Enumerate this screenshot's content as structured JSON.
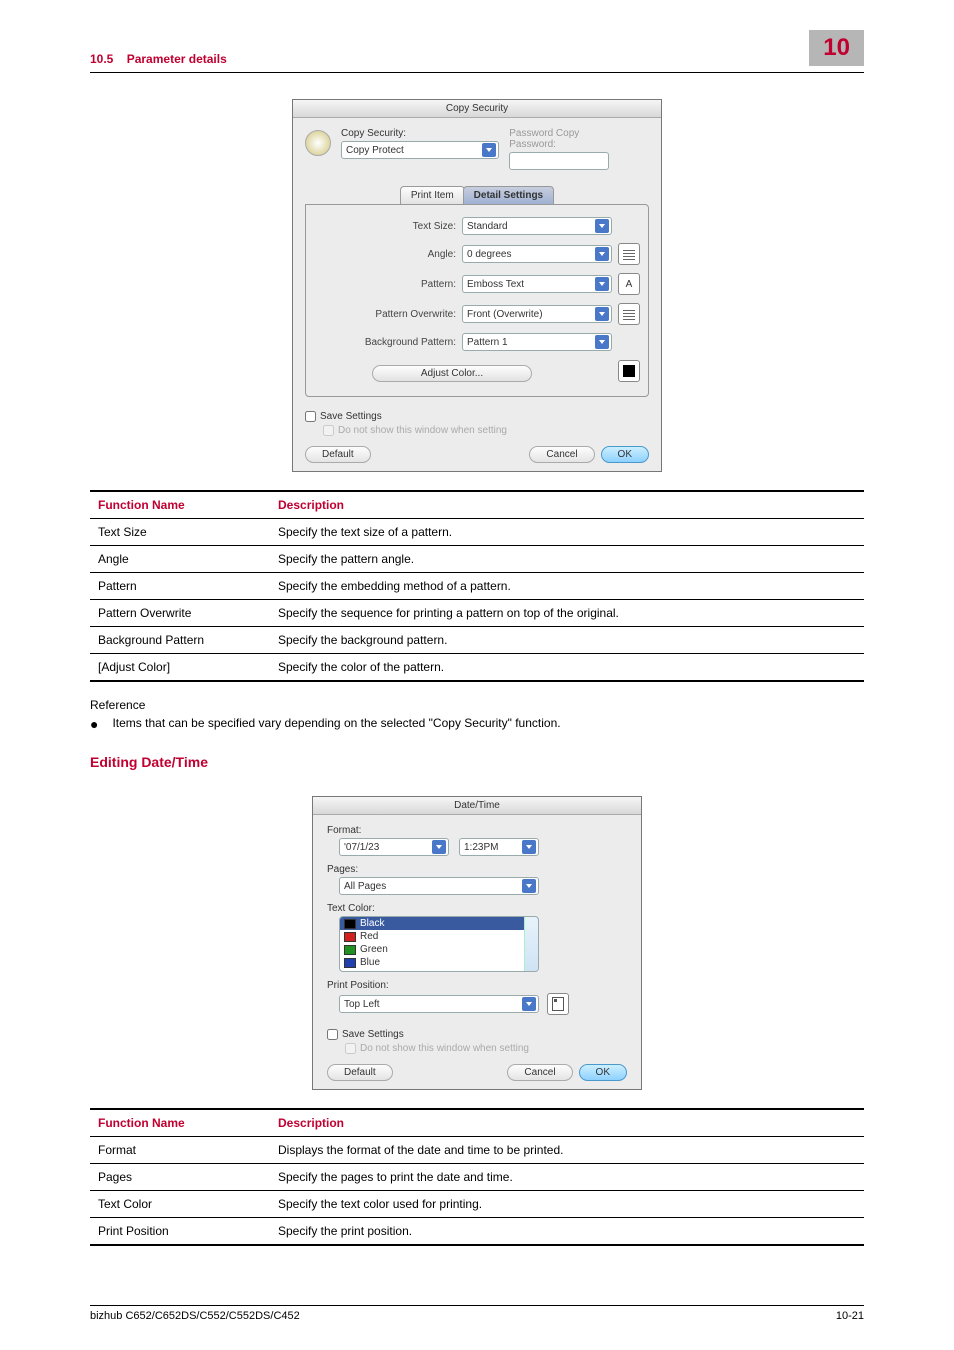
{
  "header": {
    "section_no": "10.5",
    "section_title": "Parameter details",
    "page_group": "10"
  },
  "dialog_copy": {
    "title": "Copy Security",
    "copy_security_label": "Copy Security:",
    "copy_security_value": "Copy Protect",
    "password_copy_label": "Password Copy",
    "password_label": "Password:",
    "tab_print_item": "Print Item",
    "tab_detail_settings": "Detail Settings",
    "rows": {
      "text_size": {
        "label": "Text Size:",
        "value": "Standard"
      },
      "angle": {
        "label": "Angle:",
        "value": "0 degrees"
      },
      "pattern": {
        "label": "Pattern:",
        "value": "Emboss Text"
      },
      "pattern_overwrite": {
        "label": "Pattern Overwrite:",
        "value": "Front (Overwrite)"
      },
      "background_pattern": {
        "label": "Background Pattern:",
        "value": "Pattern 1"
      }
    },
    "adjust_color": "Adjust Color...",
    "save_settings": "Save Settings",
    "donotshow": "Do not show this window when setting",
    "default": "Default",
    "cancel": "Cancel",
    "ok": "OK"
  },
  "table1": {
    "h1": "Function Name",
    "h2": "Description",
    "rows": [
      {
        "f": "Text Size",
        "d": "Specify the text size of a pattern."
      },
      {
        "f": "Angle",
        "d": "Specify the pattern angle."
      },
      {
        "f": "Pattern",
        "d": "Specify the embedding method of a pattern."
      },
      {
        "f": "Pattern Overwrite",
        "d": "Specify the sequence for printing a pattern on top of the original."
      },
      {
        "f": "Background Pattern",
        "d": "Specify the background pattern."
      },
      {
        "f": "[Adjust Color]",
        "d": "Specify the color of the pattern."
      }
    ]
  },
  "reference": {
    "title": "Reference",
    "bullet": "Items that can be specified vary depending on the selected \"Copy Security\" function."
  },
  "h_datetime": "Editing Date/Time",
  "dialog_dt": {
    "title": "Date/Time",
    "format_label": "Format:",
    "format_date": "'07/1/23",
    "format_time": "1:23PM",
    "pages_label": "Pages:",
    "pages_value": "All Pages",
    "text_color_label": "Text Color:",
    "colors": [
      {
        "name": "Black",
        "hex": "#000000",
        "selected": true
      },
      {
        "name": "Red",
        "hex": "#d02020"
      },
      {
        "name": "Green",
        "hex": "#209020"
      },
      {
        "name": "Blue",
        "hex": "#2040b0"
      }
    ],
    "print_position_label": "Print Position:",
    "print_position_value": "Top Left",
    "save_settings": "Save Settings",
    "donotshow": "Do not show this window when setting",
    "default": "Default",
    "cancel": "Cancel",
    "ok": "OK"
  },
  "table2": {
    "h1": "Function Name",
    "h2": "Description",
    "rows": [
      {
        "f": "Format",
        "d": "Displays the format of the date and time to be printed."
      },
      {
        "f": "Pages",
        "d": "Specify the pages to print the date and time."
      },
      {
        "f": "Text Color",
        "d": "Specify the text color used for printing."
      },
      {
        "f": "Print Position",
        "d": "Specify the print position."
      }
    ]
  },
  "footer": {
    "model": "bizhub C652/C652DS/C552/C552DS/C452",
    "page": "10-21"
  }
}
